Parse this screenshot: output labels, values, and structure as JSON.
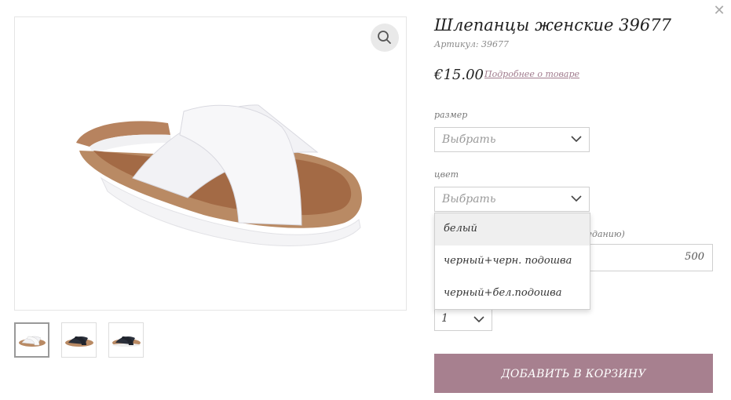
{
  "product": {
    "title": "Шлепанцы женские 39677",
    "sku": "Артикул: 39677",
    "price": "€15.00",
    "details_link": "Подробнее о товаре"
  },
  "options": {
    "size": {
      "label": "размер",
      "value": "Выбрать"
    },
    "color": {
      "label": "цвет",
      "value": "Выбрать",
      "items": [
        "белый",
        "черный+черн. подошва",
        "черный+бел.подошва"
      ],
      "hovered": "белый"
    },
    "engraving": {
      "label": "жеданию)",
      "value": "500"
    },
    "quantity": {
      "value": "1"
    }
  },
  "cart": {
    "add_label": "ДОБАВИТЬ В КОРЗИНУ"
  },
  "icons": {
    "close": "close-icon",
    "zoom": "magnifier-icon",
    "chevron": "chevron-down-icon"
  },
  "colors": {
    "accent": "#a7808f",
    "link": "#a07b8d",
    "sole": "#b7835f",
    "strap": "#f2f2f4",
    "dark_strap": "#2a2f3a"
  }
}
